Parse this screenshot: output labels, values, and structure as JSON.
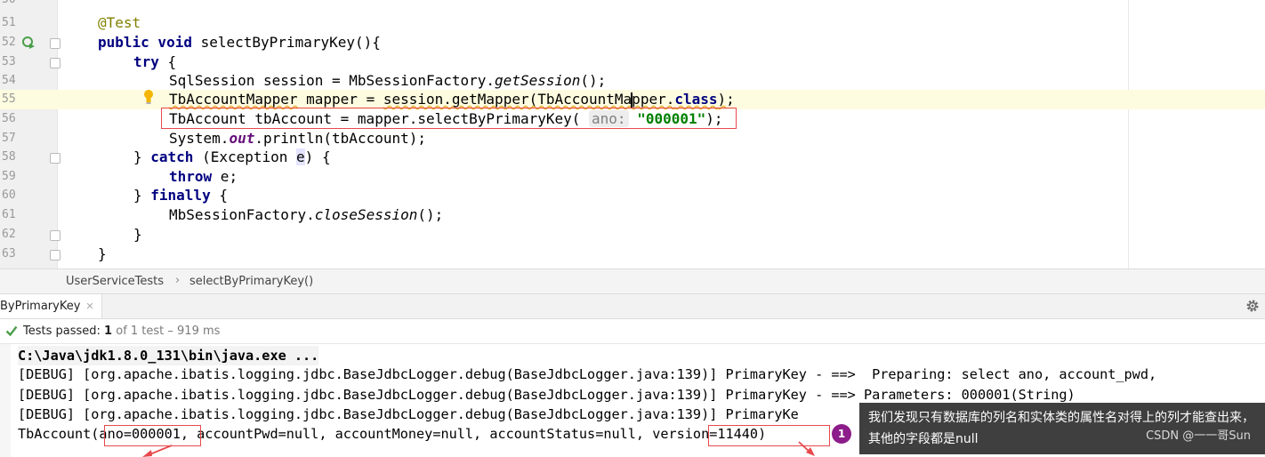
{
  "editor": {
    "lines": [
      {
        "num": "50",
        "text": ""
      },
      {
        "num": "51",
        "text": "@Test"
      },
      {
        "num": "52",
        "text": "public void selectByPrimaryKey(){"
      },
      {
        "num": "53",
        "text": "try {"
      },
      {
        "num": "54",
        "text": "SqlSession session = MbSessionFactory.getSession();"
      },
      {
        "num": "55",
        "text": "TbAccountMapper mapper = session.getMapper(TbAccountMapper.class);"
      },
      {
        "num": "56",
        "text": "TbAccount tbAccount = mapper.selectByPrimaryKey( ano: \"000001\");"
      },
      {
        "num": "57",
        "text": "System.out.println(tbAccount);"
      },
      {
        "num": "58",
        "text": "} catch (Exception e) {"
      },
      {
        "num": "59",
        "text": "throw e;"
      },
      {
        "num": "60",
        "text": "} finally {"
      },
      {
        "num": "61",
        "text": "MbSessionFactory.closeSession();"
      },
      {
        "num": "62",
        "text": "}"
      },
      {
        "num": "63",
        "text": "}"
      }
    ],
    "param_hint": "ano:",
    "param_value": "\"000001\""
  },
  "breadcrumb": {
    "items": [
      "UserServiceTests",
      "selectByPrimaryKey()"
    ],
    "separator": "›"
  },
  "run": {
    "tab_label": "ByPrimaryKey",
    "status": {
      "label": "Tests passed:",
      "count": "1",
      "of_text": "of 1 test – 919 ms"
    },
    "console": [
      "C:\\Java\\jdk1.8.0_131\\bin\\java.exe ...",
      "[DEBUG] [org.apache.ibatis.logging.jdbc.BaseJdbcLogger.debug(BaseJdbcLogger.java:139)] PrimaryKey - ==>  Preparing: select ano, account_pwd,",
      "[DEBUG] [org.apache.ibatis.logging.jdbc.BaseJdbcLogger.debug(BaseJdbcLogger.java:139)] PrimaryKey - ==> Parameters: 000001(String)",
      "[DEBUG] [org.apache.ibatis.logging.jdbc.BaseJdbcLogger.debug(BaseJdbcLogger.java:139)] PrimaryKe",
      "TbAccount(ano=000001, accountPwd=null, accountMoney=null, accountStatus=null, version=11440)"
    ]
  },
  "note": {
    "badge": "1",
    "text": "我们发现只有数据库的列名和实体类的属性名对得上的列才能查出来，其他的字段都是null",
    "watermark": "CSDN @一一哥Sun"
  },
  "colors": {
    "keyword": "#000080",
    "annotation": "#808000",
    "string": "#008000",
    "field": "#660e7a",
    "highlight_box": "#e8484c",
    "badge": "#8c1d8a",
    "success": "#4a9e4a"
  }
}
